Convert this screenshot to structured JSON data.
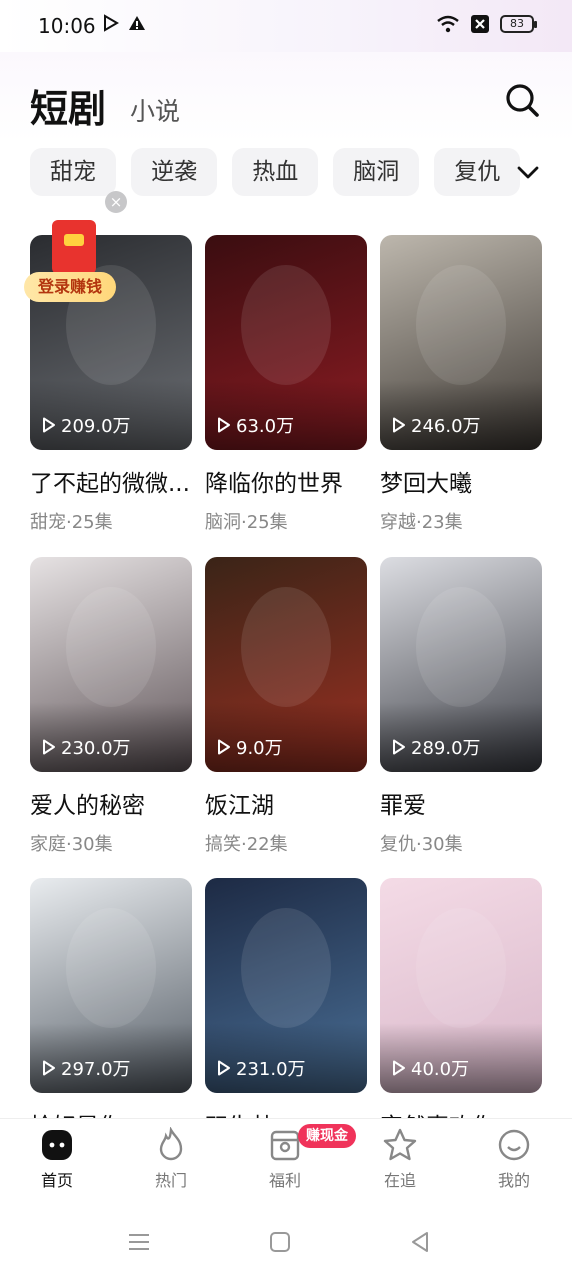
{
  "status": {
    "time": "10:06",
    "battery": "83"
  },
  "header": {
    "tab_active": "短剧",
    "tab_other": "小说"
  },
  "chips": [
    "甜宠",
    "逆袭",
    "热血",
    "脑洞",
    "复仇"
  ],
  "promo": {
    "login_label": "登录赚钱",
    "close": "×"
  },
  "cards": [
    {
      "title": "了不起的微微...",
      "meta": "甜宠·25集",
      "plays": "209.0万",
      "colors": [
        "#2a2c30",
        "#6c6f74"
      ]
    },
    {
      "title": "降临你的世界",
      "meta": "脑洞·25集",
      "plays": "63.0万",
      "colors": [
        "#3a0d10",
        "#8d1c23"
      ]
    },
    {
      "title": "梦回大曦",
      "meta": "穿越·23集",
      "plays": "246.0万",
      "colors": [
        "#bdb7ad",
        "#3d3833"
      ]
    },
    {
      "title": "爱人的秘密",
      "meta": "家庭·30集",
      "plays": "230.0万",
      "colors": [
        "#e6e2e3",
        "#5f5458"
      ]
    },
    {
      "title": "饭江湖",
      "meta": "搞笑·22集",
      "plays": "9.0万",
      "colors": [
        "#3a2417",
        "#9b3022"
      ]
    },
    {
      "title": "罪爱",
      "meta": "复仇·30集",
      "plays": "289.0万",
      "colors": [
        "#dcdde2",
        "#3b3d44"
      ]
    },
    {
      "title": "恰好是你",
      "meta": "",
      "plays": "297.0万",
      "colors": [
        "#e9ecef",
        "#555d66"
      ]
    },
    {
      "title": "双生劫",
      "meta": "",
      "plays": "231.0万",
      "colors": [
        "#1d2a44",
        "#4a6f96"
      ]
    },
    {
      "title": "突然喜欢你",
      "meta": "",
      "plays": "40.0万",
      "colors": [
        "#f4dbe6",
        "#d8b7c9"
      ]
    }
  ],
  "bottom_nav": [
    {
      "label": "首页",
      "icon": "home-icon",
      "active": true
    },
    {
      "label": "热门",
      "icon": "flame-icon",
      "active": false
    },
    {
      "label": "福利",
      "icon": "gift-icon",
      "active": false
    },
    {
      "label": "在追",
      "icon": "star-icon",
      "active": false
    },
    {
      "label": "我的",
      "icon": "profile-icon",
      "active": false
    }
  ],
  "earn_badge": "赚现金",
  "accent": "#f0335a"
}
